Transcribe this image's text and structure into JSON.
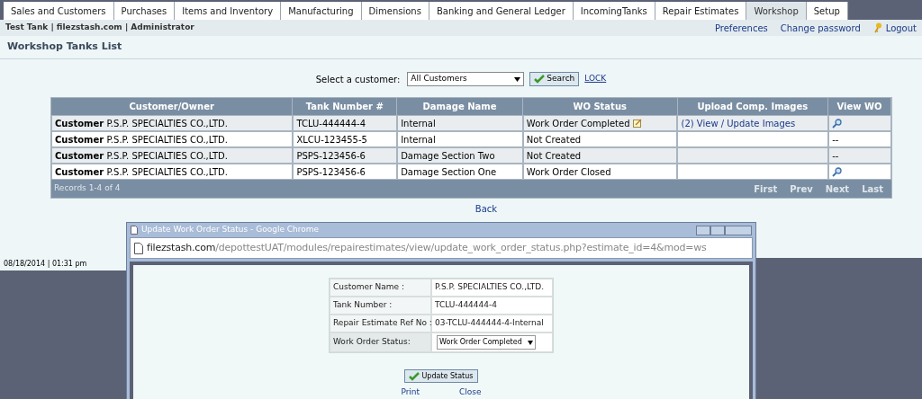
{
  "tabs": [
    {
      "label": "Sales and Customers",
      "selected": false
    },
    {
      "label": "Purchases",
      "selected": false
    },
    {
      "label": "Items and Inventory",
      "selected": false
    },
    {
      "label": "Manufacturing",
      "selected": false
    },
    {
      "label": "Dimensions",
      "selected": false
    },
    {
      "label": "Banking and General Ledger",
      "selected": false
    },
    {
      "label": "IncomingTanks",
      "selected": false
    },
    {
      "label": "Repair Estimates",
      "selected": false
    },
    {
      "label": "Workshop",
      "selected": true
    },
    {
      "label": "Setup",
      "selected": false
    }
  ],
  "header": {
    "company": "Test Tank | filezstash.com | Administrator",
    "links": [
      "Preferences",
      "Change password",
      "Logout"
    ]
  },
  "page_title": "Workshop Tanks List",
  "filter": {
    "label": "Select a customer:",
    "value": "All Customers",
    "button": "Search",
    "link": "LOCK"
  },
  "table": {
    "columns": [
      "Customer/Owner",
      "Tank Number #",
      "Damage Name",
      "WO Status",
      "Upload Comp. Images",
      "View WO"
    ],
    "rows": [
      {
        "customer": "**Customer** P.S.P. SPECIALTIES CO.,LTD.",
        "tank": "TCLU-444444-4",
        "damage": "Internal",
        "status": "Work Order Completed",
        "edit_icon": true,
        "images": "(2) View / Update Images",
        "view": {
          "kind": "icon"
        }
      },
      {
        "customer": "**Customer** P.S.P. SPECIALTIES CO.,LTD.",
        "tank": "XLCU-123455-5",
        "damage": "Internal",
        "status": "Not Created",
        "edit_icon": false,
        "view": {
          "kind": "text",
          "text": "--"
        }
      },
      {
        "customer": "**Customer** P.S.P. SPECIALTIES CO.,LTD.",
        "tank": "PSPS-123456-6",
        "damage": "Damage Section Two",
        "status": "Not Created",
        "edit_icon": false,
        "view": {
          "kind": "text",
          "text": "--"
        }
      },
      {
        "customer": "**Customer** P.S.P. SPECIALTIES CO.,LTD.",
        "tank": "PSPS-123456-6",
        "damage": "Damage Section One",
        "status": "Work Order Closed",
        "edit_icon": false,
        "view": {
          "kind": "icon"
        }
      }
    ],
    "records": "Records 1-4 of 4",
    "pager": [
      "First",
      "Prev",
      "Next",
      "Last"
    ]
  },
  "back": "Back",
  "status_bar": "08/18/2014 | 01:31 pm",
  "popup": {
    "title": "Update Work Order Status - Google Chrome",
    "url_host": "filezstash.com",
    "url_path": "/depottestUAT/modules/repairestimates/view/update_work_order_status.php?estimate_id=4&mod=ws",
    "fields": [
      {
        "label": "Customer Name :",
        "kind": "text",
        "value": "P.S.P. SPECIALTIES CO.,LTD."
      },
      {
        "label": "Tank Number :",
        "kind": "text",
        "value": "TCLU-444444-4"
      },
      {
        "label": "Repair Estimate Ref No :",
        "kind": "text",
        "value": "03-TCLU-444444-4-Internal"
      },
      {
        "label": "Work Order Status:",
        "kind": "select",
        "value": "Work Order Completed"
      }
    ],
    "button": "Update Status",
    "links": [
      "Print",
      "Close"
    ]
  }
}
